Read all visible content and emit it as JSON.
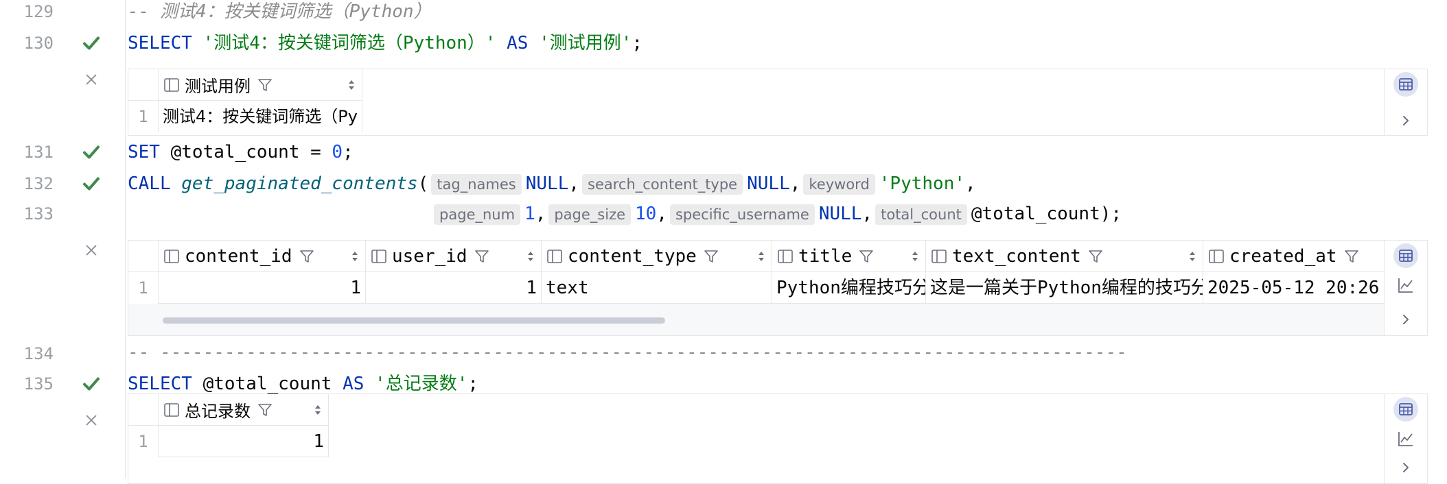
{
  "editor": {
    "lines": [
      {
        "num": "129",
        "text": "-- 测试4：按关键词筛选（Python）"
      },
      {
        "num": "130",
        "parts": [
          "SELECT",
          " ",
          "'测试4：按关键词筛选（Python）'",
          " ",
          "AS",
          " ",
          "'测试用例'",
          ";"
        ]
      },
      {
        "num": "131",
        "parts": [
          "SET",
          " @total_count = ",
          "0",
          ";"
        ]
      },
      {
        "num": "132",
        "parts": [
          "CALL",
          " ",
          "get_paginated_contents",
          "(",
          "tag_names",
          "NULL",
          ",",
          "search_content_type",
          "NULL",
          ",",
          "keyword",
          "'Python'",
          ","
        ]
      },
      {
        "num": "133",
        "parts": [
          "page_num",
          "1",
          ",",
          "page_size",
          "10",
          ",",
          "specific_username",
          "NULL",
          ",",
          "total_count",
          "@total_count);"
        ]
      },
      {
        "num": "134",
        "text": "-- ------------------------------------------------------------------------------------------"
      },
      {
        "num": "135",
        "parts": [
          "SELECT",
          " @total_count ",
          "AS",
          " ",
          "'总记录数'",
          ";"
        ]
      }
    ]
  },
  "result1": {
    "columns": [
      "测试用例"
    ],
    "rows": [
      {
        "num": "1",
        "cells": [
          "测试4：按关键词筛选（Py"
        ]
      }
    ]
  },
  "result2": {
    "columns": [
      "content_id",
      "user_id",
      "content_type",
      "title",
      "text_content",
      "created_at"
    ],
    "rows": [
      {
        "num": "1",
        "cells": [
          "1",
          "1",
          "text",
          "Python编程技巧分",
          "这是一篇关于Python编程的技巧分",
          "2025-05-12 20:26"
        ]
      }
    ]
  },
  "result3": {
    "columns": [
      "总记录数"
    ],
    "rows": [
      {
        "num": "1",
        "cells": [
          "1"
        ]
      }
    ]
  },
  "icons": {
    "success": "check-icon",
    "close": "close-icon",
    "table": "table-view-icon",
    "chart": "chart-icon",
    "expand": "chevron-right-icon",
    "filter": "filter-icon",
    "sort": "sort-icon",
    "column": "column-icon"
  },
  "colors": {
    "keyword": "#0033b3",
    "string": "#067d17",
    "number": "#1750eb",
    "function": "#00627a",
    "comment": "#8c8c8c",
    "success": "#3d8a4f"
  }
}
